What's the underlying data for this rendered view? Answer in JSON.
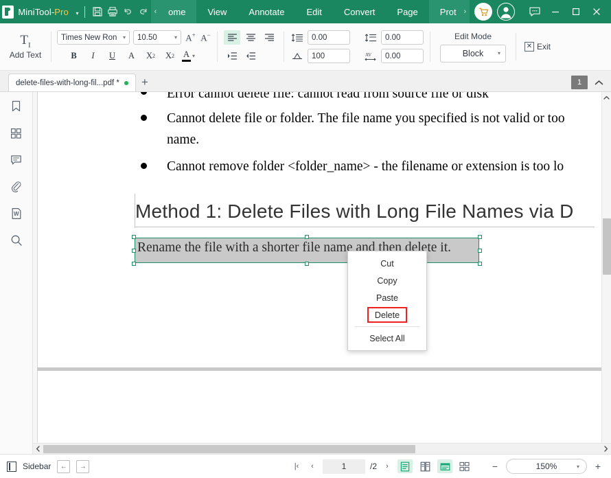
{
  "titlebar": {
    "brand_main": "MiniTool",
    "brand_sep": "-",
    "brand_pro": "Pro",
    "caret": "▾",
    "icons": {
      "save": "save-icon",
      "print": "print-icon",
      "undo": "undo-icon",
      "redo": "redo-icon"
    },
    "scroll_left": "‹",
    "scroll_right": "›",
    "menus": [
      "ome",
      "View",
      "Annotate",
      "Edit",
      "Convert",
      "Page",
      "Prot"
    ],
    "cart": "cart-icon",
    "account": "account-icon",
    "feedback": "chat-icon",
    "minimize": "—",
    "maximize": "▢",
    "close": "✕"
  },
  "ribbon": {
    "add_text_glyph": "T",
    "add_text_label": "Add Text",
    "font_name": "Times New Ron",
    "font_size": "10.50",
    "grow_font": "A",
    "shrink_font": "A",
    "bold": "B",
    "italic": "I",
    "underline": "U",
    "strike": "A",
    "superscript_base": "X",
    "superscript_sup": "2",
    "subscript_base": "X",
    "subscript_sub": "2",
    "font_color_letter": "A",
    "font_color_hex": "#111111",
    "dropdown_caret": "▾",
    "line_spacing": "0.00",
    "paragraph_spacing": "0.00",
    "horizontal_scale": "100",
    "char_spacing": "0.00",
    "edit_mode_caption": "Edit Mode",
    "edit_mode_value": "Block",
    "exit_label": "Exit"
  },
  "tabstrip": {
    "doc_tab_title": "delete-files-with-long-fil...pdf *",
    "modified_dot_color": "#1fb257",
    "new_tab": "+",
    "page_badge": "1",
    "collapse_caret": "⌃"
  },
  "left_rail": {
    "items": [
      {
        "name": "bookmark-icon"
      },
      {
        "name": "thumbnails-icon"
      },
      {
        "name": "comment-icon"
      },
      {
        "name": "attachment-icon"
      },
      {
        "name": "word-convert-icon"
      },
      {
        "name": "search-icon"
      }
    ]
  },
  "document": {
    "bullets": [
      "Error cannot delete file: cannot read from source file or disk",
      "Cannot delete file or folder. The file name you specified is not valid or too",
      "name.",
      "Cannot remove folder <folder_name> - the filename or extension is too lo"
    ],
    "heading": "Method 1: Delete Files with Long File Names via D",
    "selected_text": "Rename the file with a shorter file name and then delete it.",
    "selection_border_color": "#1f8f6a",
    "selection_fill_color": "#c9c9c9"
  },
  "context_menu": {
    "items": [
      {
        "label": "Cut",
        "highlighted": false
      },
      {
        "label": "Copy",
        "highlighted": false
      },
      {
        "label": "Paste",
        "highlighted": false
      },
      {
        "label": "Delete",
        "highlighted": true
      },
      {
        "label": "Select All",
        "highlighted": false
      }
    ],
    "highlight_color": "#f02020"
  },
  "scrollbars": {
    "v_up": "⌃",
    "v_down": "⌄",
    "h_left": "‹",
    "h_right": "›"
  },
  "statusbar": {
    "sidebar_label": "Sidebar",
    "prev_arrow": "←",
    "next_arrow": "→",
    "first_page": "|‹",
    "prev_page": "‹",
    "current_page": "1",
    "total_pages": "/2",
    "next_page": "›",
    "view_single": "single-page-view-icon",
    "view_two": "two-page-view-icon",
    "view_continuous": "continuous-view-icon",
    "view_grid": "grid-view-icon",
    "zoom_out": "−",
    "zoom_value": "150%",
    "zoom_caret": "▾",
    "zoom_in": "+"
  },
  "colors": {
    "brand_green": "#1b8760",
    "brand_green_light": "#2a9370",
    "accent_gold": "#f7c948",
    "accent_mint": "#d9f0e4"
  }
}
